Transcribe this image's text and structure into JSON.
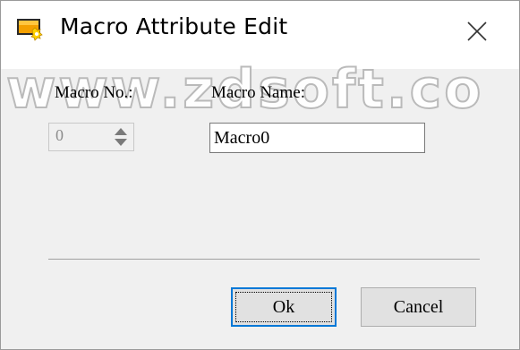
{
  "window": {
    "title": "Macro Attribute Edit",
    "icon": "macro-app-icon",
    "close_icon": "close-icon",
    "watermark": "www.zdsoft.co"
  },
  "form": {
    "macro_no_label": "Macro No.:",
    "macro_no_value": "0",
    "macro_name_label": "Macro Name:",
    "macro_name_value": "Macro0"
  },
  "buttons": {
    "ok_label": "Ok",
    "cancel_label": "Cancel"
  },
  "colors": {
    "accent": "#0078d7",
    "background": "#f0f0f0",
    "disabled_text": "#8c8c8c"
  }
}
